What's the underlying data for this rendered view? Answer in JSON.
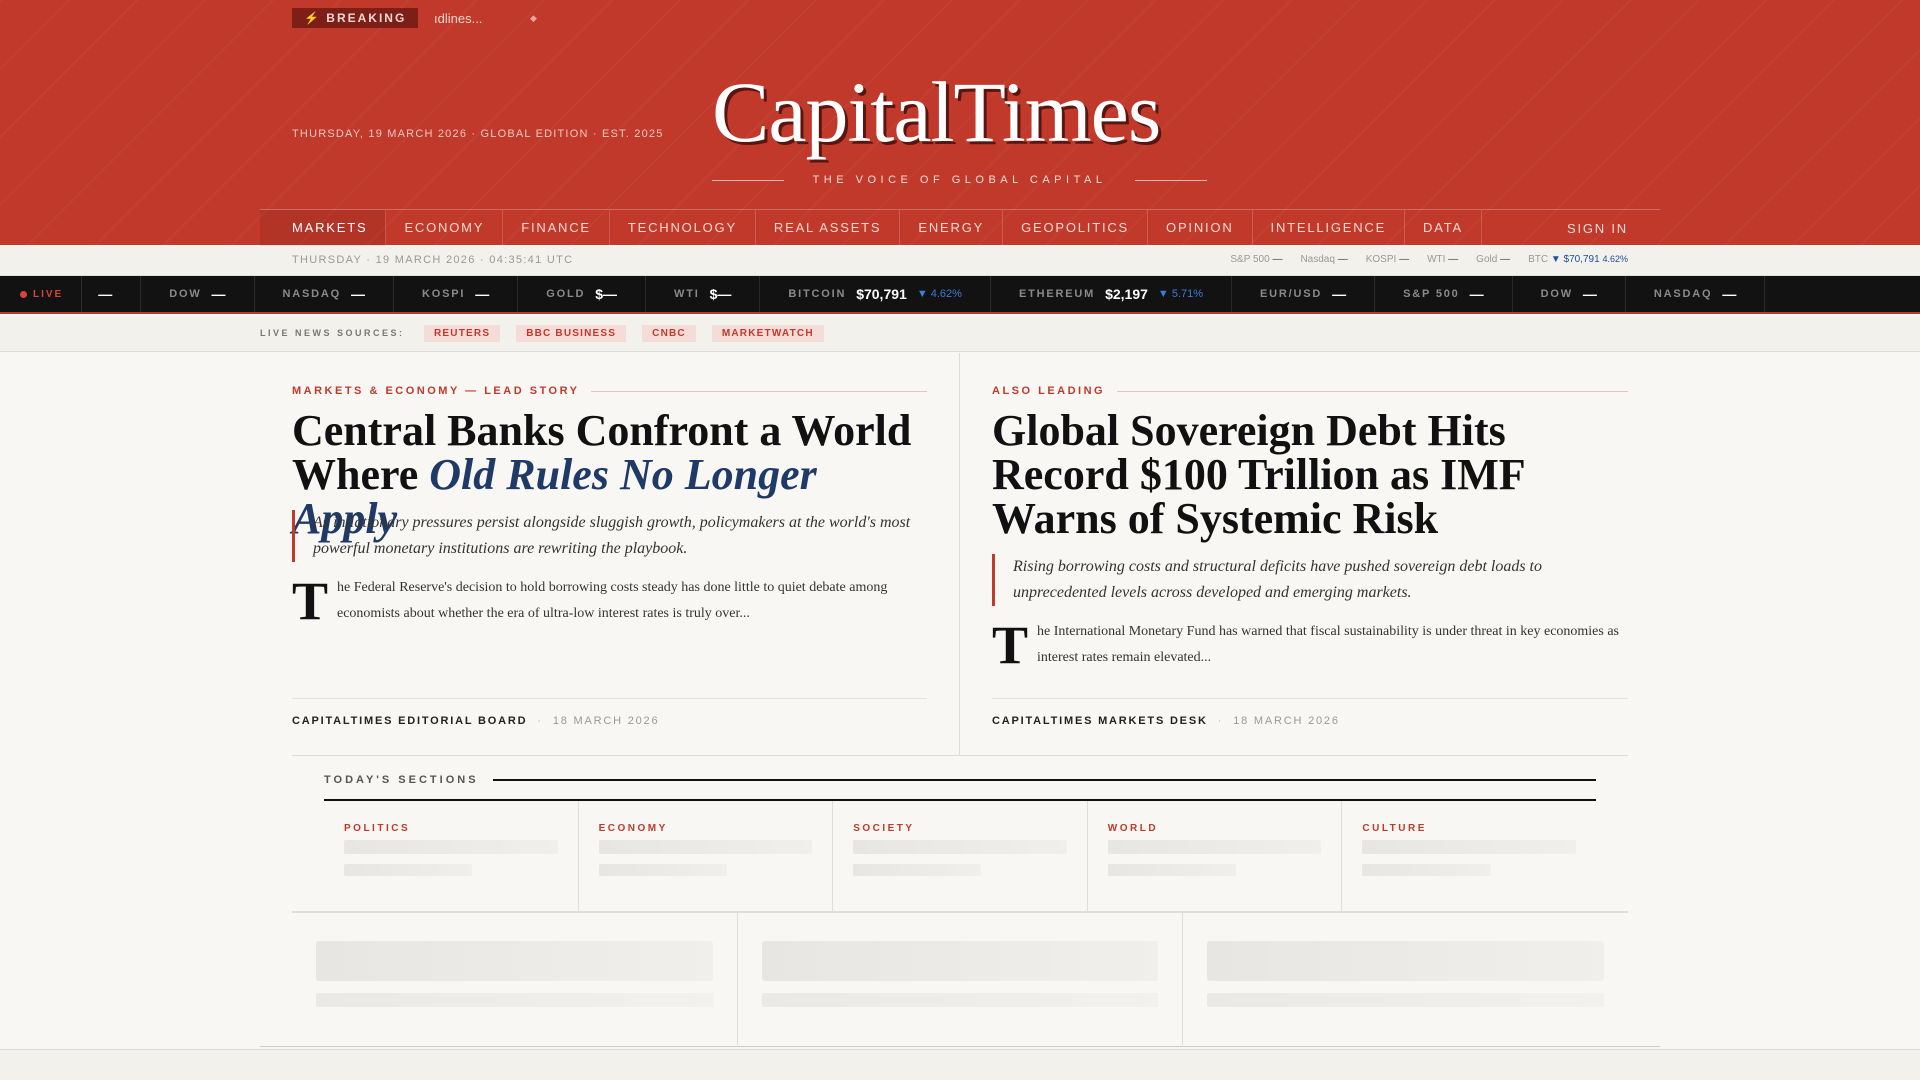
{
  "header": {
    "breaking_label": "BREAKING",
    "breaking_text": "ıdlines...",
    "diamond": "◆",
    "dateline": "THURSDAY, 19 MARCH 2026 · GLOBAL EDITION · EST. 2025",
    "logo": "CapitalTimes",
    "tagline": "THE VOICE OF GLOBAL CAPITAL"
  },
  "nav": {
    "items": [
      "MARKETS",
      "ECONOMY",
      "FINANCE",
      "TECHNOLOGY",
      "REAL ASSETS",
      "ENERGY",
      "GEOPOLITICS",
      "OPINION",
      "INTELLIGENCE",
      "DATA"
    ],
    "signin": "SIGN IN"
  },
  "subbar": {
    "datetime": "THURSDAY · 19 MARCH 2026 · 04:35:41 UTC",
    "mini": [
      {
        "label": "S&P 500",
        "value": "—"
      },
      {
        "label": "Nasdaq",
        "value": "—"
      },
      {
        "label": "KOSPI",
        "value": "—"
      },
      {
        "label": "WTI",
        "value": "—"
      },
      {
        "label": "Gold",
        "value": "—"
      },
      {
        "label": "BTC",
        "value": "▼ $70,791",
        "change": "4.62%"
      }
    ]
  },
  "ticker": {
    "live": "LIVE",
    "items": [
      {
        "label": "",
        "value": "—",
        "change": ""
      },
      {
        "label": "DOW",
        "value": "—",
        "change": ""
      },
      {
        "label": "NASDAQ",
        "value": "—",
        "change": ""
      },
      {
        "label": "KOSPI",
        "value": "—",
        "change": ""
      },
      {
        "label": "GOLD",
        "value": "$—",
        "change": ""
      },
      {
        "label": "WTI",
        "value": "$—",
        "change": ""
      },
      {
        "label": "BITCOIN",
        "value": "$70,791",
        "change": "▼ 4.62%"
      },
      {
        "label": "ETHEREUM",
        "value": "$2,197",
        "change": "▼ 5.71%"
      },
      {
        "label": "EUR/USD",
        "value": "—",
        "change": ""
      },
      {
        "label": "S&P 500",
        "value": "—",
        "change": ""
      },
      {
        "label": "DOW",
        "value": "—",
        "change": ""
      },
      {
        "label": "NASDAQ",
        "value": "—",
        "change": ""
      }
    ]
  },
  "sources": {
    "label": "LIVE NEWS SOURCES:",
    "items": [
      "REUTERS",
      "BBC BUSINESS",
      "CNBC",
      "MARKETWATCH"
    ]
  },
  "lead": {
    "kicker": "MARKETS & ECONOMY — LEAD STORY",
    "headline_part1": "Central Banks Confront a World Where ",
    "headline_em": "Old Rules No Longer Apply",
    "dek": "As inflationary pressures persist alongside sluggish growth, policymakers at the world's most powerful monetary institutions are rewriting the playbook.",
    "drop_cap": "T",
    "body": "he Federal Reserve's decision to hold borrowing costs steady has done little to quiet debate among economists about whether the era of ultra-low interest rates is truly over...",
    "author": "CAPITALTIMES EDITORIAL BOARD",
    "date": "18 MARCH 2026"
  },
  "second": {
    "kicker": "ALSO LEADING",
    "headline": "Global Sovereign Debt Hits Record $100 Trillion as IMF Warns of Systemic Risk",
    "dek": "Rising borrowing costs and structural deficits have pushed sovereign debt loads to unprecedented levels across developed and emerging markets.",
    "drop_cap": "T",
    "body": "he International Monetary Fund has warned that fiscal sustainability is under threat in key economies as interest rates remain elevated...",
    "author": "CAPITALTIMES MARKETS DESK",
    "date": "18 MARCH 2026"
  },
  "sections": {
    "title": "TODAY'S SECTIONS",
    "items": [
      "POLITICS",
      "ECONOMY",
      "SOCIETY",
      "WORLD",
      "CULTURE"
    ]
  },
  "byline_sep": "·",
  "colors": {
    "brand": "#c0392b",
    "ink": "#111111",
    "headline_em": "#1f3a66",
    "down": "#3b7bd9"
  }
}
